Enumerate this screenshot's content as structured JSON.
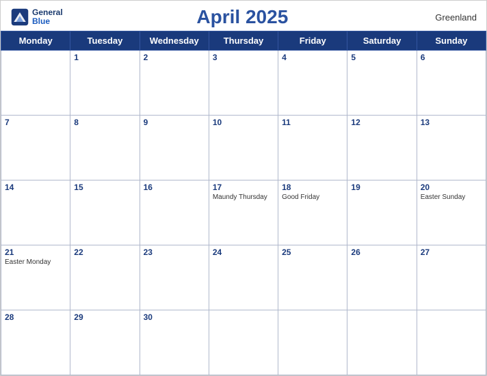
{
  "header": {
    "title": "April 2025",
    "region": "Greenland",
    "logo_line1": "General",
    "logo_line2": "Blue"
  },
  "weekdays": [
    "Monday",
    "Tuesday",
    "Wednesday",
    "Thursday",
    "Friday",
    "Saturday",
    "Sunday"
  ],
  "weeks": [
    [
      {
        "day": "",
        "holiday": ""
      },
      {
        "day": "1",
        "holiday": ""
      },
      {
        "day": "2",
        "holiday": ""
      },
      {
        "day": "3",
        "holiday": ""
      },
      {
        "day": "4",
        "holiday": ""
      },
      {
        "day": "5",
        "holiday": ""
      },
      {
        "day": "6",
        "holiday": ""
      }
    ],
    [
      {
        "day": "7",
        "holiday": ""
      },
      {
        "day": "8",
        "holiday": ""
      },
      {
        "day": "9",
        "holiday": ""
      },
      {
        "day": "10",
        "holiday": ""
      },
      {
        "day": "11",
        "holiday": ""
      },
      {
        "day": "12",
        "holiday": ""
      },
      {
        "day": "13",
        "holiday": ""
      }
    ],
    [
      {
        "day": "14",
        "holiday": ""
      },
      {
        "day": "15",
        "holiday": ""
      },
      {
        "day": "16",
        "holiday": ""
      },
      {
        "day": "17",
        "holiday": "Maundy Thursday"
      },
      {
        "day": "18",
        "holiday": "Good Friday"
      },
      {
        "day": "19",
        "holiday": ""
      },
      {
        "day": "20",
        "holiday": "Easter Sunday"
      }
    ],
    [
      {
        "day": "21",
        "holiday": "Easter Monday"
      },
      {
        "day": "22",
        "holiday": ""
      },
      {
        "day": "23",
        "holiday": ""
      },
      {
        "day": "24",
        "holiday": ""
      },
      {
        "day": "25",
        "holiday": ""
      },
      {
        "day": "26",
        "holiday": ""
      },
      {
        "day": "27",
        "holiday": ""
      }
    ],
    [
      {
        "day": "28",
        "holiday": ""
      },
      {
        "day": "29",
        "holiday": ""
      },
      {
        "day": "30",
        "holiday": ""
      },
      {
        "day": "",
        "holiday": ""
      },
      {
        "day": "",
        "holiday": ""
      },
      {
        "day": "",
        "holiday": ""
      },
      {
        "day": "",
        "holiday": ""
      }
    ]
  ]
}
